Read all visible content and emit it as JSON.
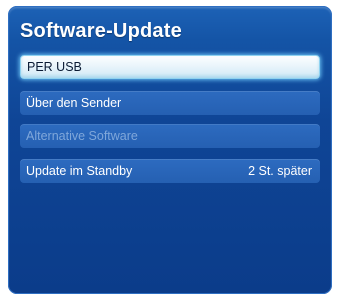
{
  "dialog": {
    "title": "Software-Update",
    "items": [
      {
        "label": "PER USB",
        "value": "",
        "state": "selected"
      },
      {
        "label": "Über den Sender",
        "value": "",
        "state": "normal"
      },
      {
        "label": "Alternative Software",
        "value": "",
        "state": "disabled"
      },
      {
        "label": "Update im Standby",
        "value": "2 St. später",
        "state": "normal"
      }
    ]
  },
  "colors": {
    "panel_background": "#0f4596",
    "item_background": "#2560b2",
    "selected_background": "#eaf5fb",
    "selected_glow": "#8fd2f0",
    "disabled_text": "#7fa7da"
  }
}
